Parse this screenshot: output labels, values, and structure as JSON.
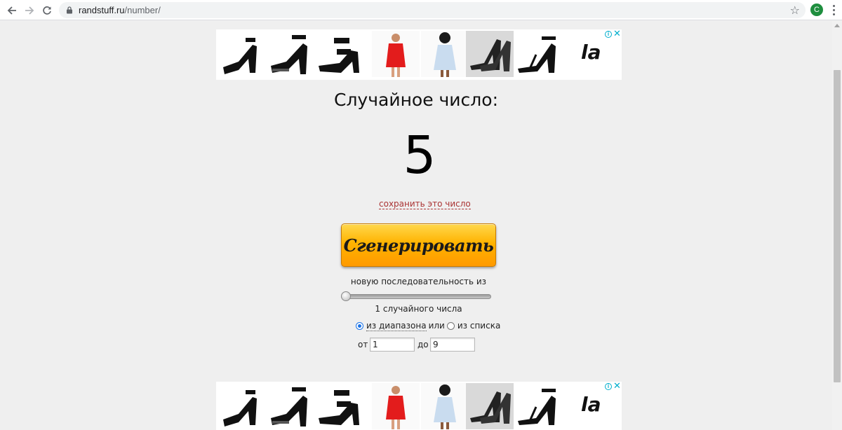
{
  "browser": {
    "url_host": "randstuff.ru",
    "url_path": "/number/",
    "profile_initial": "C"
  },
  "ads": {
    "brand": "la",
    "info": "i",
    "close": "✕"
  },
  "main": {
    "title": "Случайное число:",
    "number": "5",
    "save_link": "сохранить это число",
    "generate_button": "Сгенерировать",
    "sequence_label": "новую последовательность из",
    "count_label": "1 случайного числа",
    "slider_level": 0,
    "mode": {
      "range_label": "из диапазона",
      "or_text": "или",
      "list_label": "из списка",
      "selected": "range"
    },
    "range": {
      "from_label": "от",
      "from_value": "1",
      "to_label": "до",
      "to_value": "9"
    }
  },
  "colors": {
    "accent_orange": "#ffb300",
    "link_red": "#a33",
    "radio_blue": "#1a73e8",
    "ad_blue": "#00aecd"
  }
}
